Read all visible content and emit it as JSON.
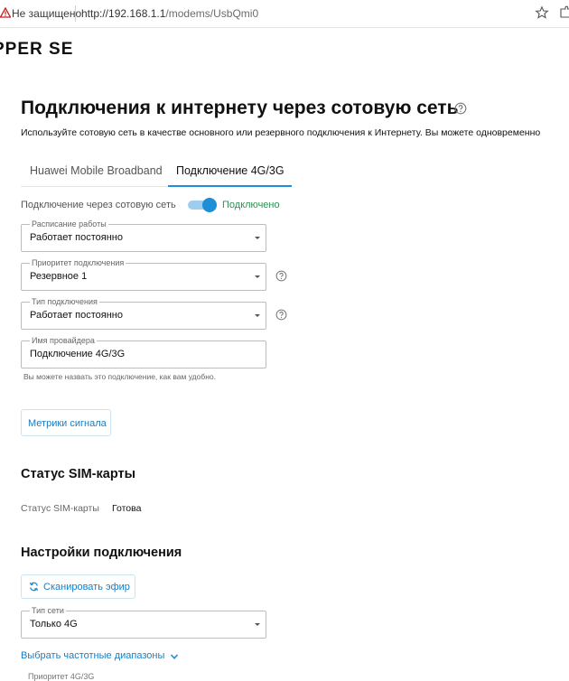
{
  "browser": {
    "security_label": "Не защищено",
    "url_host": "http://192.168.1.1",
    "url_path": "/modems/UsbQmi0"
  },
  "header": {
    "logo_text": "PPER SE"
  },
  "page": {
    "title": "Подключения к интернету через сотовую сеть",
    "description": "Используйте сотовую сеть в качестве основного или резервного подключения к Интернету. Вы можете одновременно"
  },
  "tabs": [
    {
      "label": "Huawei Mobile Broadband",
      "active": false
    },
    {
      "label": "Подключение 4G/3G",
      "active": true
    }
  ],
  "connection": {
    "toggle_label": "Подключение через сотовую сеть",
    "toggle_on": true,
    "status": "Подключено",
    "status_color": "#2f8f52"
  },
  "fields": {
    "schedule": {
      "label": "Расписание работы",
      "value": "Работает постоянно"
    },
    "priority": {
      "label": "Приоритет подключения",
      "value": "Резервное 1"
    },
    "type": {
      "label": "Тип подключения",
      "value": "Работает постоянно"
    },
    "provider": {
      "label": "Имя провайдера",
      "value": "Подключение 4G/3G",
      "hint": "Вы можете назвать это подключение, как вам удобно."
    }
  },
  "buttons": {
    "metrics": "Метрики сигнала",
    "scan": "Сканировать эфир"
  },
  "sim": {
    "section_title": "Статус SIM-карты",
    "label": "Статус SIM-карты",
    "value": "Готова"
  },
  "settings": {
    "section_title": "Настройки подключения",
    "network_type": {
      "label": "Тип сети",
      "value": "Только 4G"
    },
    "bands_link": "Выбрать частотные диапазоны"
  },
  "cut_text": "Приоритет 4G/3G",
  "colors": {
    "accent": "#1c8fd6",
    "link": "#1c7cc0",
    "success": "#2f8f52"
  },
  "icons": {
    "warning": "warning-triangle-icon",
    "star": "star-icon",
    "help": "question-circle-icon",
    "caret": "caret-down-icon",
    "refresh": "refresh-icon",
    "chevron": "chevron-down-icon"
  }
}
